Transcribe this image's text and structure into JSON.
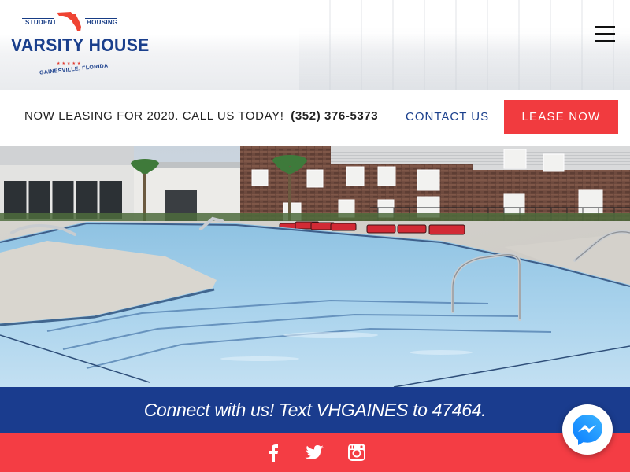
{
  "header": {
    "logo": {
      "top_left_word": "STUDENT",
      "top_right_word": "HOUSING",
      "name": "VARSITY HOUSE",
      "stars": "★★★★★",
      "city": "GAINESVILLE, FLORIDA"
    },
    "menu_icon": "hamburger-menu-icon"
  },
  "leasing_bar": {
    "message": "NOW LEASING FOR 2020. CALL US TODAY!",
    "phone": "(352) 376-5373",
    "contact_label": "CONTACT US",
    "lease_label": "LEASE NOW"
  },
  "hero": {
    "image_icon": "pool-photo"
  },
  "connect_bar": {
    "text": "Connect with us! Text VHGAINES to 47464."
  },
  "social": {
    "items": [
      {
        "icon": "facebook-icon"
      },
      {
        "icon": "twitter-icon"
      },
      {
        "icon": "instagram-icon"
      }
    ]
  },
  "messenger": {
    "icon": "messenger-icon"
  },
  "colors": {
    "brand_blue": "#1a3c8e",
    "brand_red": "#f13b3f",
    "social_red": "#f43d44"
  }
}
